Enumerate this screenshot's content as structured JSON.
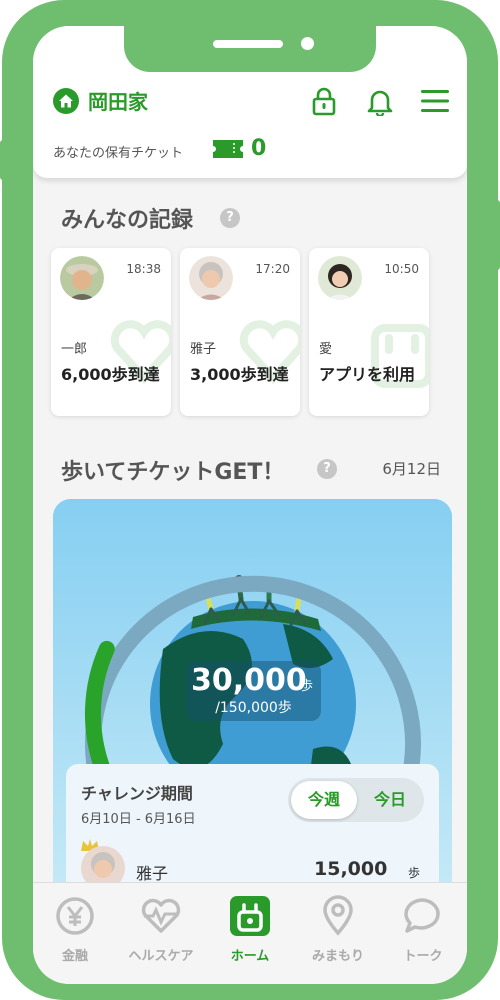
{
  "header": {
    "family_name": "岡田家",
    "ticket_label": "あなたの保有チケット",
    "ticket_count": "0"
  },
  "records": {
    "title": "みんなの記録",
    "help": "?",
    "cards": [
      {
        "time": "18:38",
        "name": "一郎",
        "desc": "6,000歩到達"
      },
      {
        "time": "17:20",
        "name": "雅子",
        "desc": "3,000歩到達"
      },
      {
        "time": "10:50",
        "name": "愛",
        "desc": "アプリを利用"
      }
    ]
  },
  "challenge": {
    "title": "歩いてチケットGET！",
    "help": "?",
    "date": "6月12日",
    "steps": "30,000",
    "steps_unit": "歩",
    "goal": "/150,000歩",
    "progress": 0.2,
    "period_title": "チャレンジ期間",
    "period_dates": "6月10日 - 6月16日",
    "toggle_week": "今週",
    "toggle_day": "今日",
    "rank_name": "雅子",
    "rank_steps": "15,000",
    "rank_unit": "歩"
  },
  "tabs": [
    {
      "label": "金融",
      "icon": "yen-icon",
      "active": false
    },
    {
      "label": "ヘルスケア",
      "icon": "heart-pulse-icon",
      "active": false
    },
    {
      "label": "ホーム",
      "icon": "home-app-icon",
      "active": true
    },
    {
      "label": "みまもり",
      "icon": "location-pin-icon",
      "active": false
    },
    {
      "label": "トーク",
      "icon": "chat-bubble-icon",
      "active": false
    }
  ],
  "colors": {
    "brand_green": "#2a9a2a",
    "frame_green": "#6fbe6f",
    "sky_blue": "#8ed3f4"
  }
}
